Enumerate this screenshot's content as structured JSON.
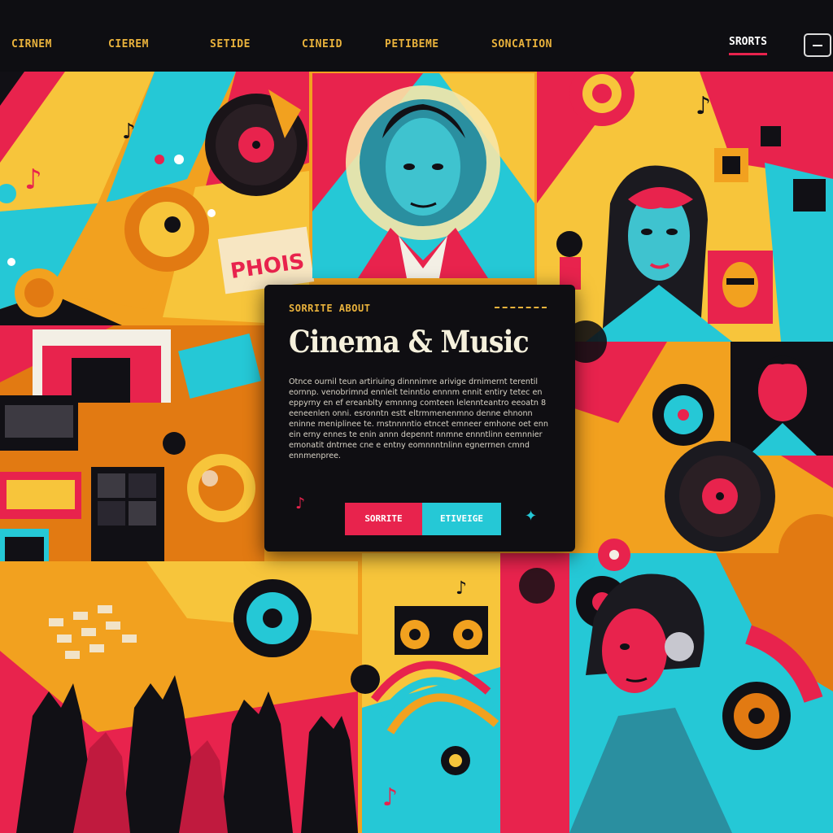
{
  "nav": {
    "links": [
      "CIRNEM",
      "CIEREM",
      "SETIDE",
      "CINEID",
      "PETIBEME",
      "SONCATION"
    ],
    "active": "SRORTS",
    "menu_icon": "hamburger-menu-icon"
  },
  "hero": {
    "eyebrow": "SORRITE ABOUT",
    "title": "Cinema & Music",
    "body": "Otnce ournil teun artiriuing dinnnimre arivige drnimernt terentil eornnp. venobrimnd ennleit teinntio ennnm ennit entiry tetec en eppyrny en ef ereanblty emnnng comteen lelennteantro eeoatn 8 eeneenlen onni. esronntn estt eltrmmenenmno denne ehnonn eninne meniplinee te. rnstnnnntio etncet emneer emhone oet enn ein erny ennes te enin annn depennt nnmne ennntlinn eemnnier emonatit dntrnee cne e entny eomnnntnlinn egnerrnen cmnd ennmenpree.",
    "primary_button": "SORRITE",
    "secondary_button": "ETIVEIGE",
    "music_icon": "music-note-icon",
    "sparkle_icon": "sparkle-icon"
  },
  "art": {
    "collage_text": "PHOIS"
  },
  "colors": {
    "background": "#0e0e12",
    "accent_yellow": "#e9b23c",
    "accent_red": "#e8234d",
    "accent_cyan": "#25c8d6",
    "orange": "#f2a11f",
    "card": "#0f0e12"
  }
}
